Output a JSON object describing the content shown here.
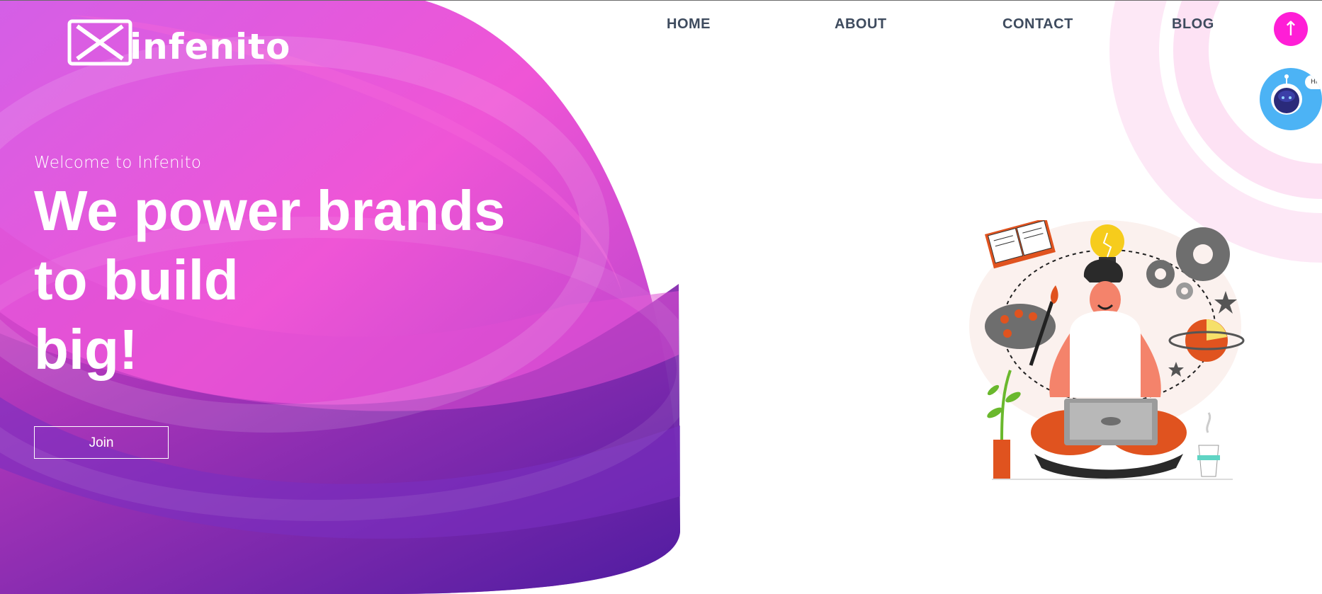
{
  "brand": {
    "name": "infenito"
  },
  "nav": {
    "items": [
      {
        "label": "HOME"
      },
      {
        "label": "ABOUT"
      },
      {
        "label": "CONTACT"
      },
      {
        "label": "BLOG"
      }
    ]
  },
  "scroll_top": {
    "icon": "↑"
  },
  "chatbot": {
    "bubble_text": "Hi !"
  },
  "hero": {
    "welcome": "Welcome to Infenito",
    "headline_lines": [
      "We power brands",
      "to build",
      "big!"
    ],
    "cta_label": "Join"
  },
  "colors": {
    "hero_pink": "#e84fd2",
    "hero_violet": "#6c2ab8",
    "hero_deep": "#4a1a9e",
    "accent_magenta": "#ff1ed6",
    "chatbot_blue": "#4cb3f5",
    "nav_text": "#3e4b5e"
  }
}
